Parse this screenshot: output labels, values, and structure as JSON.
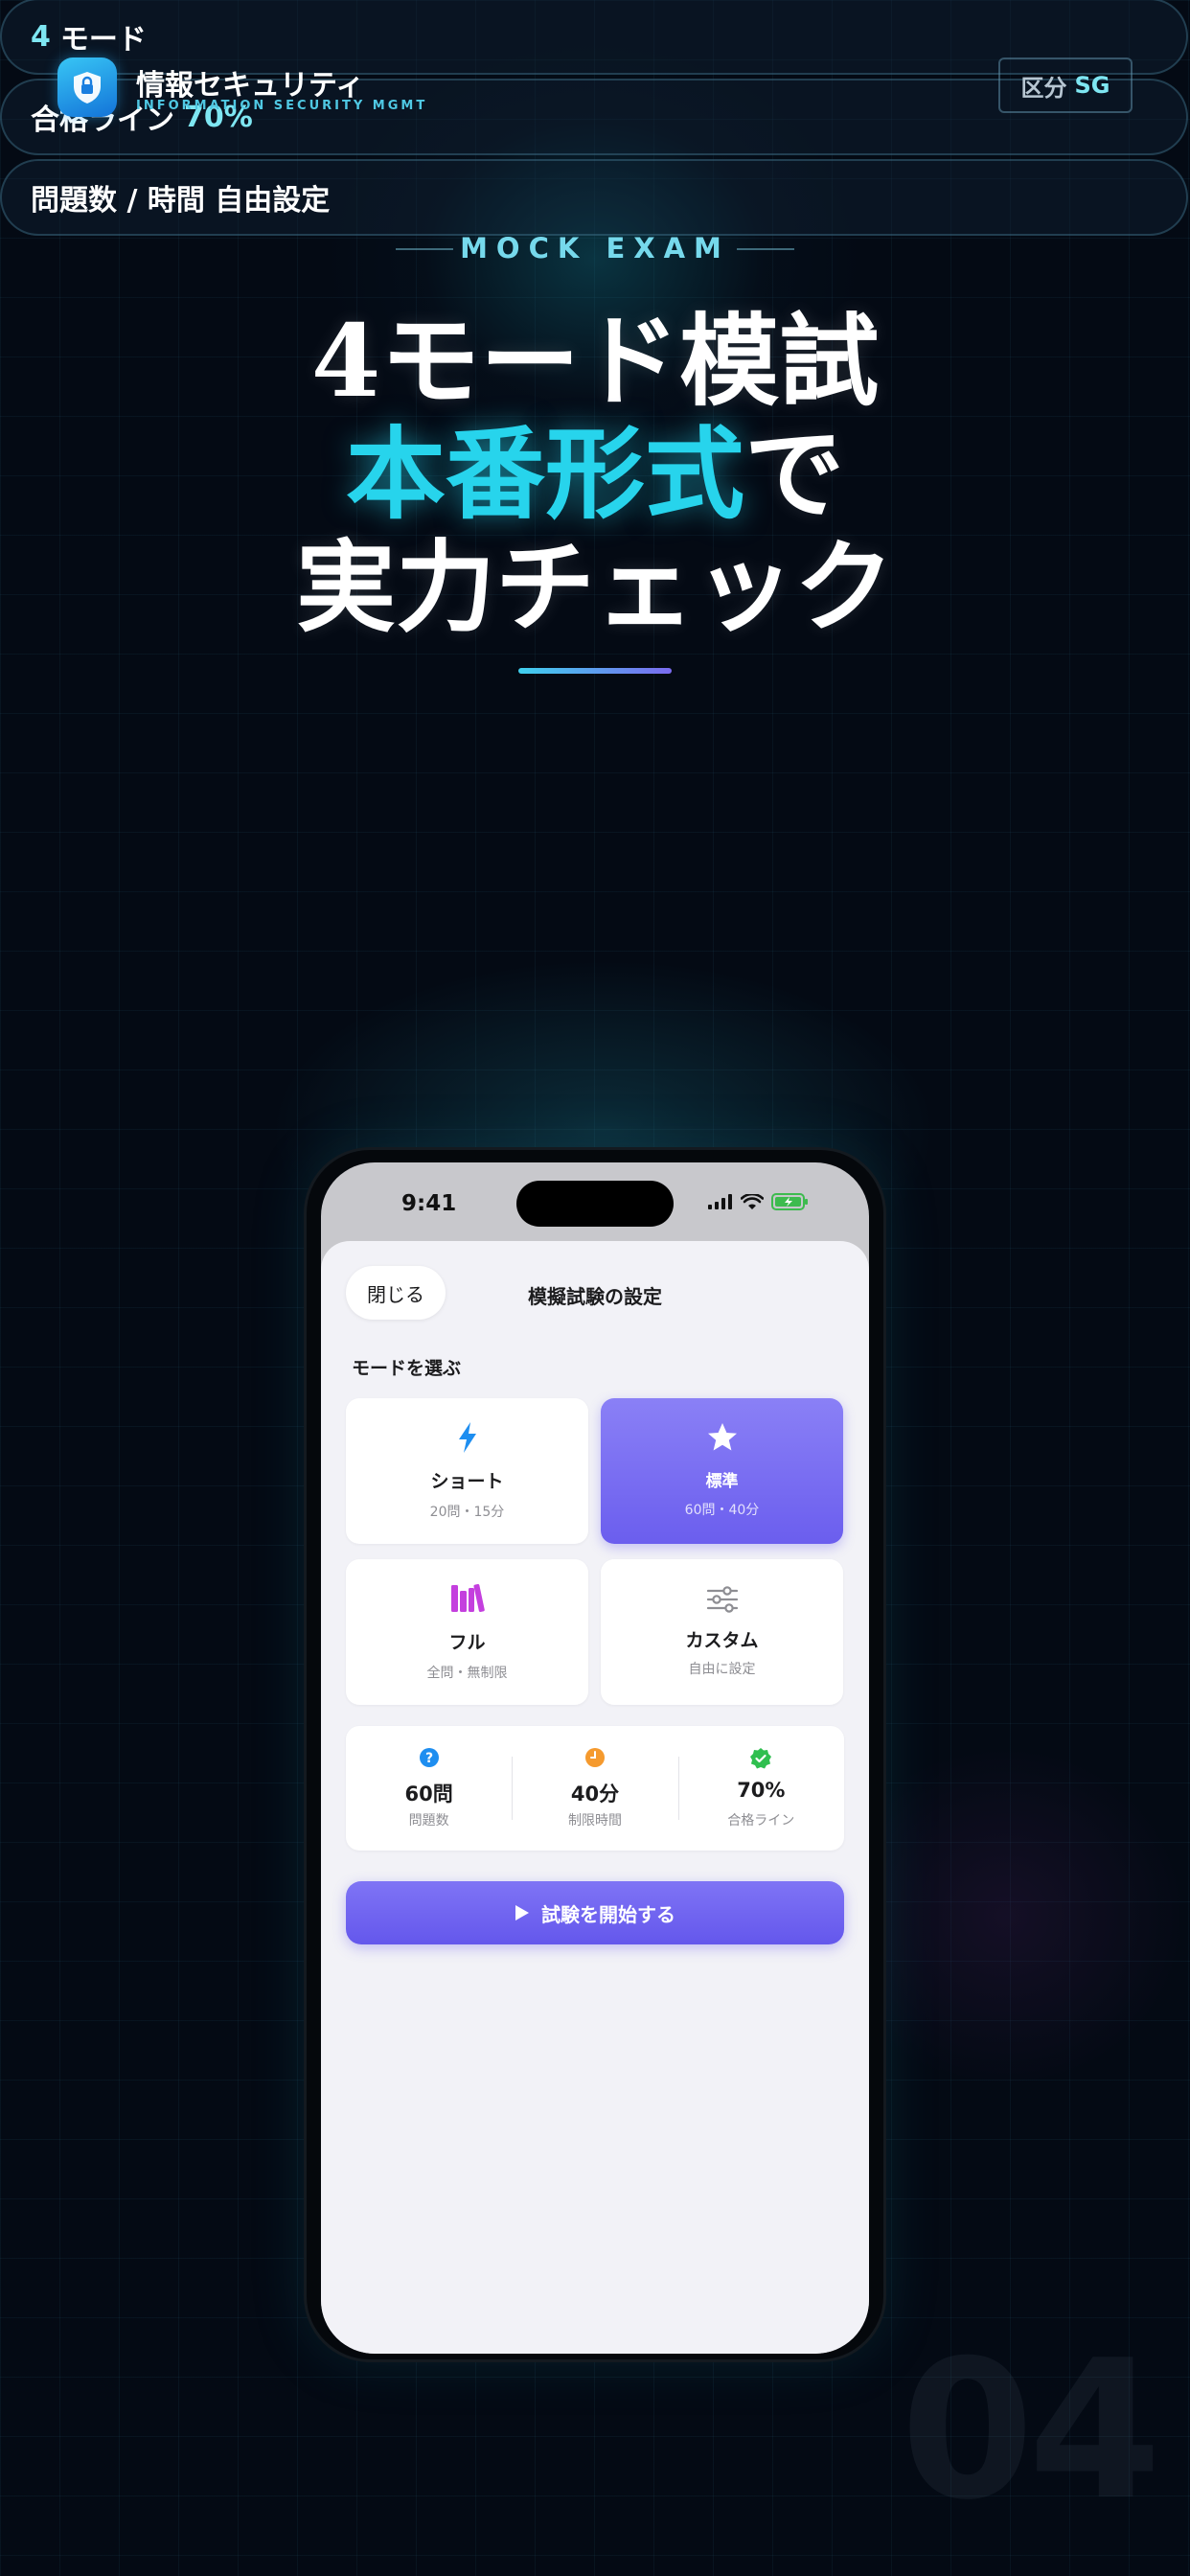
{
  "features": [
    {
      "accent": "4",
      "text": "モード",
      "accent_after": ""
    },
    {
      "accent": "",
      "text": "合格ライン",
      "accent_after": "70%"
    },
    {
      "accent": "",
      "text": "問題数 / 時間 自由設定",
      "accent_after": ""
    }
  ],
  "brand": {
    "title": "情報セキュリティ",
    "subtitle": "INFORMATION SECURITY MGMT",
    "division_label": "区分",
    "division_code": "SG"
  },
  "hero": {
    "eyebrow": "MOCK EXAM",
    "line1": "4モード模試",
    "line2_accent": "本番形式",
    "line2_rest": "で",
    "line3": "実力チェック"
  },
  "page_number": "04",
  "phone": {
    "status_time": "9:41",
    "sheet": {
      "close_label": "閉じる",
      "title": "模擬試験の設定",
      "section_label": "モードを選ぶ",
      "modes": [
        {
          "name": "ショート",
          "desc": "20問・15分",
          "icon": "lightning-icon",
          "selected": false
        },
        {
          "name": "標準",
          "desc": "60問・40分",
          "icon": "star-icon",
          "selected": true
        },
        {
          "name": "フル",
          "desc": "全問・無制限",
          "icon": "books-icon",
          "selected": false
        },
        {
          "name": "カスタム",
          "desc": "自由に設定",
          "icon": "sliders-icon",
          "selected": false
        }
      ],
      "summary": [
        {
          "value": "60問",
          "label": "問題数",
          "icon": "question-icon",
          "color": "#1e8ef0"
        },
        {
          "value": "40分",
          "label": "制限時間",
          "icon": "clock-icon",
          "color": "#f59a2e"
        },
        {
          "value": "70%",
          "label": "合格ライン",
          "icon": "check-badge-icon",
          "color": "#2fbf4f"
        }
      ],
      "start_label": "試験を開始する"
    }
  },
  "colors": {
    "accent_cyan": "#27d4ec",
    "accent_purple": "#6b5eee",
    "background": "#040a14"
  }
}
